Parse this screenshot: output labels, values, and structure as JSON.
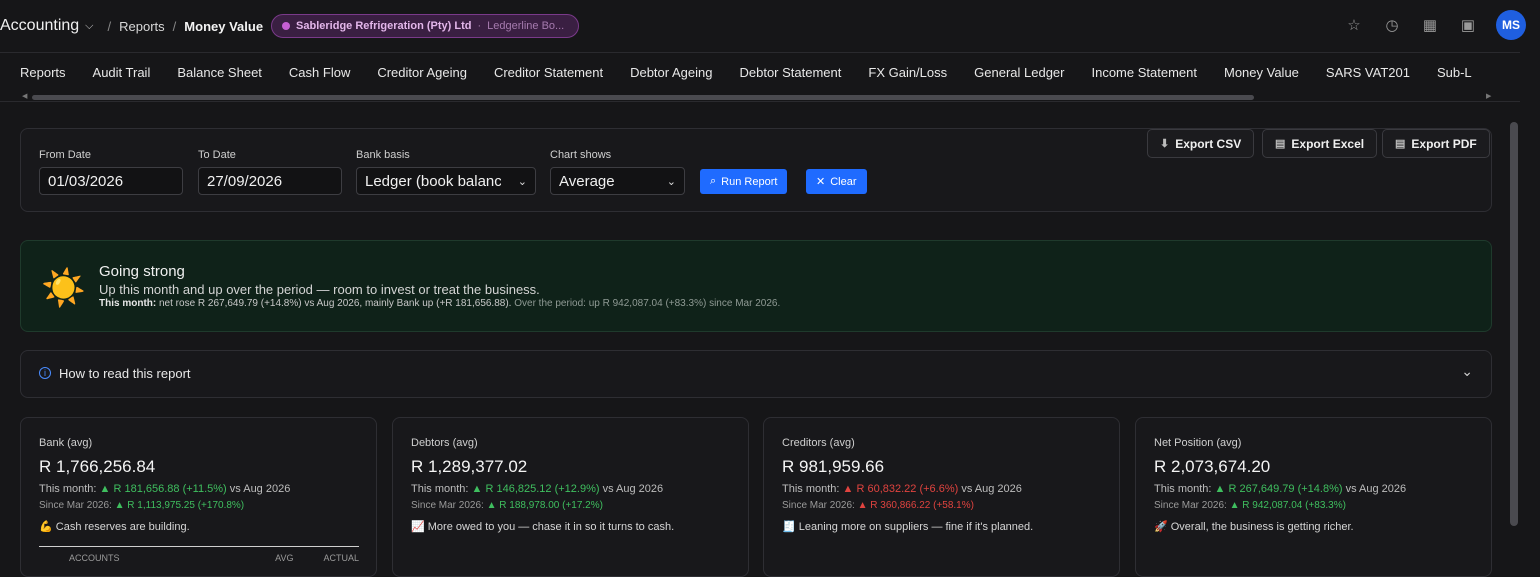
{
  "header": {
    "app_title": "Accounting",
    "breadcrumb_parent": "Reports",
    "breadcrumb_current": "Money Value",
    "company_name": "Sableridge Refrigeration (Pty) Ltd",
    "company_separator": "·",
    "company_sub": "Ledgerline Bo...",
    "avatar_initials": "MS"
  },
  "tabs": [
    "Reports",
    "Audit Trail",
    "Balance Sheet",
    "Cash Flow",
    "Creditor Ageing",
    "Creditor Statement",
    "Debtor Ageing",
    "Debtor Statement",
    "FX Gain/Loss",
    "General Ledger",
    "Income Statement",
    "Money Value",
    "SARS VAT201",
    "Sub-L"
  ],
  "filters": {
    "from_date_label": "From Date",
    "from_date_value": "01/03/2026",
    "to_date_label": "To Date",
    "to_date_value": "27/09/2026",
    "bank_basis_label": "Bank basis",
    "bank_basis_value": "Ledger (book balance)",
    "chart_shows_label": "Chart shows",
    "chart_shows_value": "Average",
    "run_label": "Run Report",
    "clear_label": "Clear",
    "export_csv": "Export CSV",
    "export_excel": "Export Excel",
    "export_pdf": "Export PDF"
  },
  "banner": {
    "title": "Going strong",
    "subtitle": "Up this month and up over the period — room to invest or treat the business.",
    "this_month_label": "This month:",
    "this_month_text": "net rose R 267,649.79 (+14.8%) vs Aug 2026, mainly Bank up (+R 181,656.88).",
    "period_text": "Over the period: up R 942,087.04 (+83.3%) since Mar 2026."
  },
  "howto": {
    "label": "How to read this report"
  },
  "cards": [
    {
      "label": "Bank (avg)",
      "value": "R 1,766,256.84",
      "this_month_label": "This month:",
      "this_month_delta": "▲ R 181,656.88 (+11.5%)",
      "this_month_suffix": "vs Aug 2026",
      "since_label": "Since Mar 2026:",
      "since_delta": "▲ R 1,113,975.25 (+170.8%)",
      "note": "💪 Cash reserves are building.",
      "direction": "up"
    },
    {
      "label": "Debtors (avg)",
      "value": "R 1,289,377.02",
      "this_month_label": "This month:",
      "this_month_delta": "▲ R 146,825.12 (+12.9%)",
      "this_month_suffix": "vs Aug 2026",
      "since_label": "Since Mar 2026:",
      "since_delta": "▲ R 188,978.00 (+17.2%)",
      "note": "📈 More owed to you — chase it in so it turns to cash.",
      "direction": "up"
    },
    {
      "label": "Creditors (avg)",
      "value": "R 981,959.66",
      "this_month_label": "This month:",
      "this_month_delta": "▲ R 60,832.22 (+6.6%)",
      "this_month_suffix": "vs Aug 2026",
      "since_label": "Since Mar 2026:",
      "since_delta": "▲ R 360,866.22 (+58.1%)",
      "note": "🧾 Leaning more on suppliers — fine if it's planned.",
      "direction": "down"
    },
    {
      "label": "Net Position (avg)",
      "value": "R 2,073,674.20",
      "this_month_label": "This month:",
      "this_month_delta": "▲ R 267,649.79 (+14.8%)",
      "this_month_suffix": "vs Aug 2026",
      "since_label": "Since Mar 2026:",
      "since_delta": "▲ R 942,087.04 (+83.3%)",
      "note": "🚀 Overall, the business is getting richer.",
      "direction": "up"
    }
  ],
  "bank_table_head": {
    "accounts": "ACCOUNTS",
    "avg": "AVG",
    "actual": "ACTUAL"
  }
}
